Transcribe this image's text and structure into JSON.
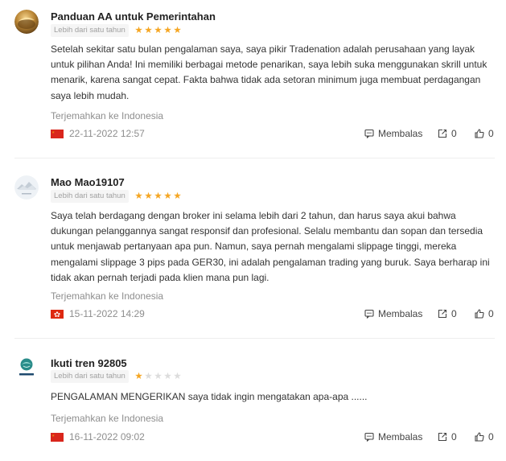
{
  "colors": {
    "star_on": "#f5a623",
    "star_off": "#dcdcdc",
    "muted_text": "#8e8e8e"
  },
  "reviews": [
    {
      "name": "Panduan AA untuk Pemerintahan",
      "duration": "Lebih dari satu tahun",
      "rating": 5,
      "content": "Setelah sekitar satu bulan pengalaman saya, saya pikir Tradenation adalah perusahaan yang layak untuk pilihan Anda! Ini memiliki berbagai metode penarikan, saya lebih suka menggunakan skrill untuk menarik, karena sangat cepat. Fakta bahwa tidak ada setoran minimum juga membuat perdagangan saya lebih mudah.",
      "translate_label": "Terjemahkan ke Indonesia",
      "flag_icon": "china-flag-icon",
      "date": "22-11-2022 12:57",
      "reply_label": "Membalas",
      "share_count": "0",
      "like_count": "0"
    },
    {
      "name": "Mao Mao19107",
      "duration": "Lebih dari satu tahun",
      "rating": 5,
      "content": "Saya telah berdagang dengan broker ini selama lebih dari 2 tahun, dan harus saya akui bahwa dukungan pelanggannya sangat responsif dan profesional. Selalu membantu dan sopan dan tersedia untuk menjawab pertanyaan apa pun. Namun, saya pernah mengalami slippage tinggi, mereka mengalami slippage 3 pips pada GER30, ini adalah pengalaman trading yang buruk. Saya berharap ini tidak akan pernah terjadi pada klien mana pun lagi.",
      "translate_label": "Terjemahkan ke Indonesia",
      "flag_icon": "hong-kong-flag-icon",
      "date": "15-11-2022 14:29",
      "reply_label": "Membalas",
      "share_count": "0",
      "like_count": "0"
    },
    {
      "name": "Ikuti tren 92805",
      "duration": "Lebih dari satu tahun",
      "rating": 1,
      "content": "PENGALAMAN MENGERIKAN saya tidak ingin mengatakan apa-apa ......",
      "translate_label": "Terjemahkan ke Indonesia",
      "flag_icon": "china-flag-icon",
      "date": "16-11-2022 09:02",
      "reply_label": "Membalas",
      "share_count": "0",
      "like_count": "0"
    }
  ]
}
